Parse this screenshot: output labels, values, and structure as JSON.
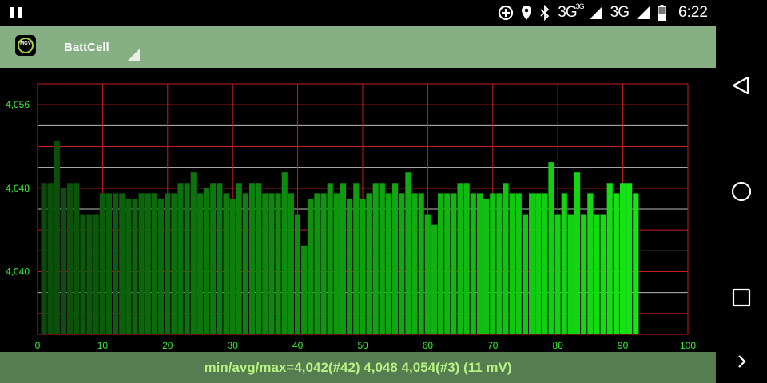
{
  "status_bar": {
    "network_1": "3G",
    "network_1_super": "3G",
    "network_2": "3G",
    "time": "6:22",
    "icons": [
      "pause-icon",
      "data-saver-icon",
      "location-icon",
      "bluetooth-icon",
      "signal-icon",
      "battery-icon"
    ]
  },
  "app_bar": {
    "app_icon_text": "MGV",
    "title": "BattCell"
  },
  "chart_data": {
    "type": "bar",
    "xlabel": "",
    "ylabel": "",
    "xlim": [
      0,
      100
    ],
    "ylim": [
      4034,
      4058
    ],
    "x_ticks": [
      "0",
      "10",
      "20",
      "30",
      "40",
      "50",
      "60",
      "70",
      "80",
      "90",
      "100"
    ],
    "y_ticks": [
      "4,040",
      "4,048",
      "4,056"
    ],
    "x": [
      1,
      2,
      3,
      4,
      5,
      6,
      7,
      8,
      9,
      10,
      11,
      12,
      13,
      14,
      15,
      16,
      17,
      18,
      19,
      20,
      21,
      22,
      23,
      24,
      25,
      26,
      27,
      28,
      29,
      30,
      31,
      32,
      33,
      34,
      35,
      36,
      37,
      38,
      39,
      40,
      41,
      42,
      43,
      44,
      45,
      46,
      47,
      48,
      49,
      50,
      51,
      52,
      53,
      54,
      55,
      56,
      57,
      58,
      59,
      60,
      61,
      62,
      63,
      64,
      65,
      66,
      67,
      68,
      69,
      70,
      71,
      72,
      73,
      74,
      75,
      76,
      77,
      78,
      79,
      80,
      81,
      82,
      83,
      84,
      85,
      86,
      87,
      88,
      89,
      90,
      91,
      92,
      93,
      94,
      95
    ],
    "values": [
      4048.5,
      4048.5,
      4052.5,
      4048,
      4048.5,
      4048.5,
      4045.5,
      4045.5,
      4045.5,
      4047.5,
      4047.5,
      4047.5,
      4047.5,
      4047,
      4047,
      4047.5,
      4047.5,
      4047.5,
      4047,
      4047.5,
      4047.5,
      4048.5,
      4048.5,
      4049.5,
      4047.5,
      4048,
      4048.5,
      4048.5,
      4047.5,
      4047,
      4048.5,
      4047.5,
      4048.5,
      4048.5,
      4047.5,
      4047.5,
      4047.5,
      4049.5,
      4047.5,
      4045.5,
      4042.5,
      4047,
      4047.5,
      4047.5,
      4048.5,
      4047.5,
      4048.5,
      4047,
      4048.5,
      4047,
      4047.5,
      4048.5,
      4048.5,
      4047.5,
      4048.5,
      4047.5,
      4049.5,
      4047.5,
      4047.5,
      4045.5,
      4044.5,
      4047.5,
      4047.5,
      4047.5,
      4048.5,
      4048.5,
      4047.5,
      4047.5,
      4047,
      4047.5,
      4047.5,
      4048.5,
      4047.5,
      4047.5,
      4045.5,
      4047.5,
      4047.5,
      4047.5,
      4050.5,
      4045.5,
      4047.5,
      4045.5,
      4049.5,
      4045.5,
      4047.5,
      4045.5,
      4045.5,
      4048.5,
      4047.5,
      4048.5,
      4048.5,
      4047.5
    ],
    "bar_color_start": "#0a4d0a",
    "bar_color_end": "#14e514",
    "grid": true,
    "grid_colors": {
      "vertical": "#c81e1e",
      "horizontal_major": "#c81e1e",
      "horizontal_minor": "#bdbdbd"
    },
    "tick_color": "#33ee33"
  },
  "footer": {
    "stats": "min/avg/max=4,042(#42) 4,048 4,054(#3)  (11 mV)"
  },
  "nav_bar": {
    "icons": [
      "back-icon",
      "home-icon",
      "recents-icon",
      "chevron-right-icon"
    ]
  }
}
